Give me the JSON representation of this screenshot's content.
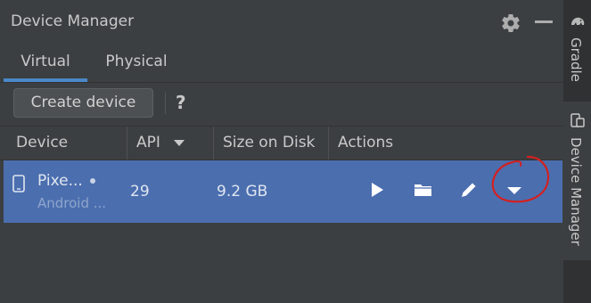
{
  "header": {
    "title": "Device Manager",
    "settings_icon": "gear-icon",
    "minimize_icon": "minimize-icon"
  },
  "tabs": [
    {
      "label": "Virtual",
      "active": true
    },
    {
      "label": "Physical",
      "active": false
    }
  ],
  "toolbar": {
    "create_label": "Create device",
    "help_label": "?"
  },
  "table": {
    "columns": [
      "Device",
      "API",
      "Size on Disk",
      "Actions"
    ],
    "sorted_column": "API",
    "rows": [
      {
        "name": "Pixe...",
        "subtitle": "Android ...",
        "api": "29",
        "size": "9.2 GB",
        "online": true,
        "actions": [
          "run-icon",
          "folder-icon",
          "edit-icon",
          "more-dropdown-icon"
        ]
      }
    ]
  },
  "side_bar": {
    "tabs": [
      {
        "label": "Gradle",
        "icon": "gradle-elephant-icon",
        "active": false
      },
      {
        "label": "Device Manager",
        "icon": "device-manager-icon",
        "active": true
      }
    ]
  },
  "colors": {
    "background": "#3c3f41",
    "selection": "#4b6eaf",
    "tab_underline": "#4a88c7",
    "annotation": "#d42020"
  }
}
